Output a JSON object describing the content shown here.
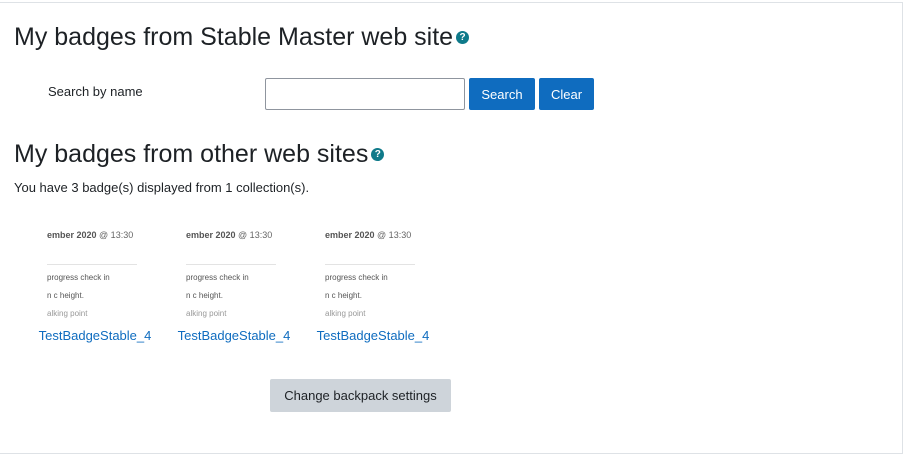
{
  "local_section": {
    "title": "My badges from Stable Master web site",
    "help_glyph": "?",
    "search_label": "Search by name",
    "search_value": "",
    "search_button": "Search",
    "clear_button": "Clear"
  },
  "other_section": {
    "title": "My badges from other web sites",
    "help_glyph": "?",
    "summary": "You have 3 badge(s) displayed from 1 collection(s)."
  },
  "badges": [
    {
      "name": "TestBadgeStable_4",
      "image_text": {
        "line1_bold": "ember 2020 ",
        "line1_rest": "@ 13:30",
        "line2": "progress check in",
        "line3": "n c height.",
        "line4": "alking point"
      }
    },
    {
      "name": "TestBadgeStable_4",
      "image_text": {
        "line1_bold": "ember 2020 ",
        "line1_rest": "@ 13:30",
        "line2": "progress check in",
        "line3": "n c height.",
        "line4": "alking point"
      }
    },
    {
      "name": "TestBadgeStable_4",
      "image_text": {
        "line1_bold": "ember 2020 ",
        "line1_rest": "@ 13:30",
        "line2": "progress check in",
        "line3": "n c height.",
        "line4": "alking point"
      }
    }
  ],
  "backpack_button": "Change backpack settings",
  "colors": {
    "primary": "#0f6cbf",
    "help_icon": "#0f7a8a",
    "secondary_button": "#ced4da"
  }
}
